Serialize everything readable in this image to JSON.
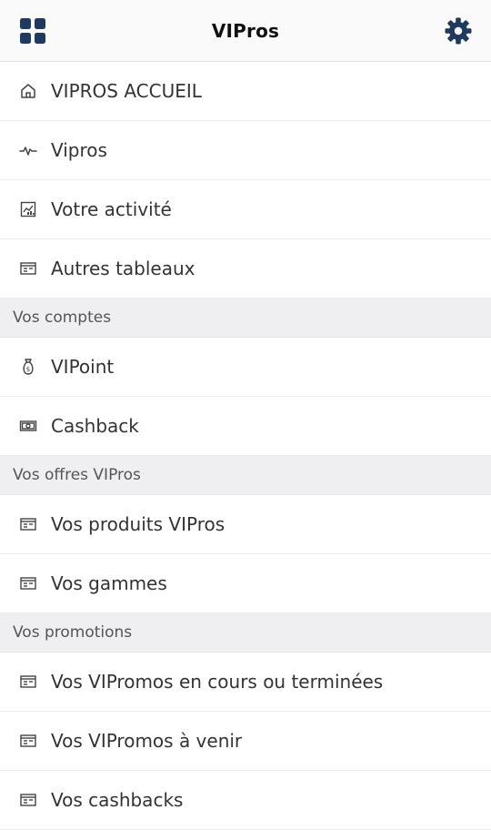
{
  "header": {
    "title": "VIPros",
    "menu_icon": "grid-icon",
    "settings_icon": "gear-icon",
    "accent": "#1f3a60"
  },
  "nav": {
    "home": {
      "label": "VIPROS ACCUEIL",
      "icon": "home-icon"
    },
    "vipros": {
      "label": "Vipros",
      "icon": "pulse-icon"
    },
    "activity": {
      "label": "Votre activité",
      "icon": "chart-icon"
    },
    "boards": {
      "label": "Autres tableaux",
      "icon": "table-icon"
    }
  },
  "sections": {
    "accounts": {
      "title": "Vos comptes",
      "items": [
        {
          "label": "VIPoint",
          "icon": "money-bag-icon"
        },
        {
          "label": "Cashback",
          "icon": "banknote-icon"
        }
      ]
    },
    "offers": {
      "title": "Vos offres VIPros",
      "items": [
        {
          "label": "Vos produits VIPros",
          "icon": "table-icon"
        },
        {
          "label": "Vos gammes",
          "icon": "table-icon"
        }
      ]
    },
    "promotions": {
      "title": "Vos promotions",
      "items": [
        {
          "label": "Vos VIPromos en cours ou terminées",
          "icon": "table-icon"
        },
        {
          "label": "Vos VIPromos à venir",
          "icon": "table-icon"
        },
        {
          "label": "Vos cashbacks",
          "icon": "table-icon"
        }
      ]
    }
  }
}
